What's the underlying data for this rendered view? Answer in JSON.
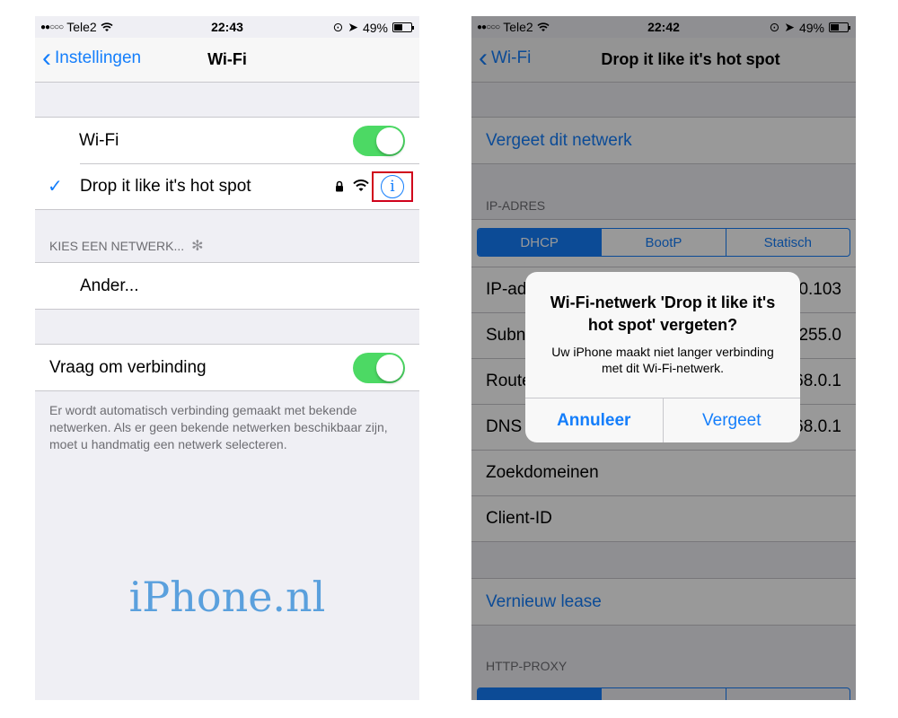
{
  "left": {
    "status": {
      "carrier": "Tele2",
      "time": "22:43",
      "battery": "49%",
      "battery_level": 0.49
    },
    "nav": {
      "back_label": "Instellingen",
      "title": "Wi-Fi"
    },
    "wifi_row": {
      "label": "Wi-Fi",
      "on": true
    },
    "network_row": {
      "name": "Drop it like it's hot spot"
    },
    "choose_header": "KIES EEN NETWERK...",
    "other_row": "Ander...",
    "ask_row": {
      "label": "Vraag om verbinding",
      "on": true
    },
    "footer": "Er wordt automatisch verbinding gemaakt met bekende netwerken. Als er geen bekende netwerken beschikbaar zijn, moet u handmatig een netwerk selecteren.",
    "watermark": "iPhone.nl"
  },
  "right": {
    "status": {
      "carrier": "Tele2",
      "time": "22:42",
      "battery": "49%",
      "battery_level": 0.49
    },
    "nav": {
      "back_label": "Wi-Fi",
      "title": "Drop it like it's hot spot"
    },
    "forget_row": "Vergeet dit netwerk",
    "ip_header": "IP-ADRES",
    "segments": [
      "DHCP",
      "BootP",
      "Statisch"
    ],
    "ip_rows": [
      {
        "label": "IP-ad",
        "value": "0.103"
      },
      {
        "label": "Subn",
        "value": "255.0"
      },
      {
        "label": "Route",
        "value": "68.0.1"
      },
      {
        "label": "DNS",
        "value": "68.0.1"
      }
    ],
    "search_domains": "Zoekdomeinen",
    "client_id": "Client-ID",
    "renew_lease": "Vernieuw lease",
    "proxy_header": "HTTP-PROXY",
    "alert": {
      "title": "Wi-Fi-netwerk 'Drop it like it's hot spot' vergeten?",
      "message": "Uw iPhone maakt niet langer verbinding met dit Wi-Fi-netwerk.",
      "cancel": "Annuleer",
      "confirm": "Vergeet"
    }
  },
  "colors": {
    "accent": "#147efb",
    "toggle_on": "#4cd964",
    "highlight_box": "#d0021b",
    "background": "#efeff4"
  }
}
